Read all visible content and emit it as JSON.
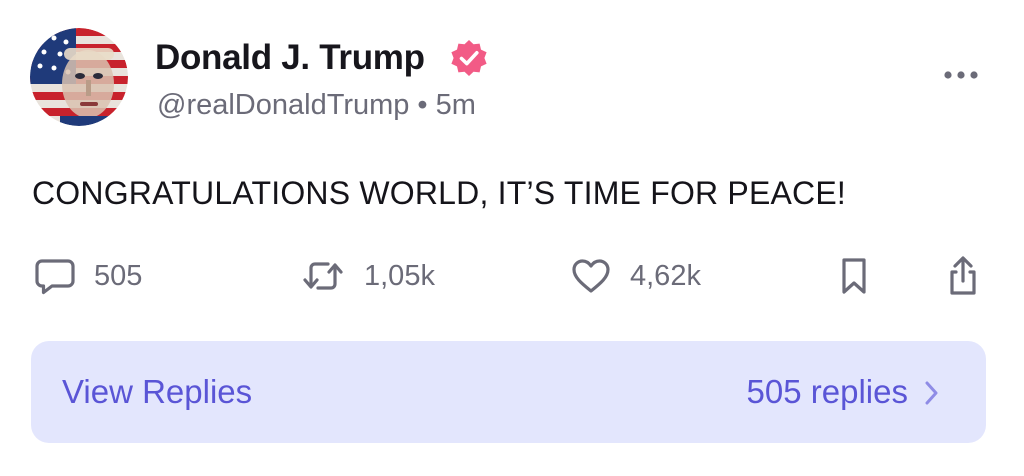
{
  "author": {
    "display_name": "Donald J. Trump",
    "handle": "@realDonaldTrump",
    "separator": "•",
    "time_ago": "5m",
    "verified": true
  },
  "post": {
    "text": "CONGRATULATIONS WORLD, IT’S TIME FOR PEACE!"
  },
  "actions": {
    "replies": "505",
    "reposts": "1,05k",
    "likes": "4,62k"
  },
  "replies_bar": {
    "label": "View Replies",
    "count_label": "505 replies"
  },
  "colors": {
    "accent": "#5a55d6",
    "replies_bg": "#e3e6fd",
    "verified": "#f25b86",
    "muted": "#6b6b78",
    "text": "#15141a"
  },
  "icons": {
    "more": "more-horizontal-icon",
    "reply": "comment-icon",
    "repost": "repost-icon",
    "like": "heart-icon",
    "bookmark": "bookmark-icon",
    "share": "share-icon",
    "verified": "verified-badge-icon",
    "chevron": "chevron-right-icon"
  }
}
